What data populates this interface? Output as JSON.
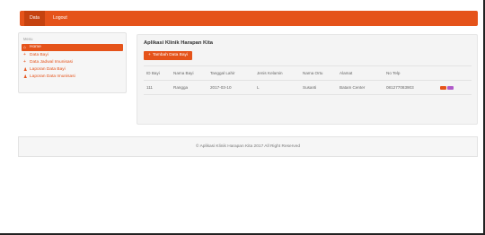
{
  "topbar": {
    "items": [
      {
        "label": "Data"
      },
      {
        "label": "Logout"
      }
    ]
  },
  "sidebar": {
    "heading": "Menu",
    "items": [
      {
        "label": "Home",
        "icon": "home-icon"
      },
      {
        "label": "Data Bayi",
        "icon": "plus-icon"
      },
      {
        "label": "Data Jadwal Imunisasi",
        "icon": "plus-icon"
      },
      {
        "label": "Laporan Data Bayi",
        "icon": "user-icon"
      },
      {
        "label": "Laporan Data Imunisasi",
        "icon": "user-icon"
      }
    ]
  },
  "content": {
    "title": "Aplikasi Klinik Harapan Kita",
    "add_button_label": "Tambah Data Bayi",
    "table": {
      "headers": [
        "ID Bayi",
        "Nama Bayi",
        "Tanggal Lahir",
        "Jenis Kelamin",
        "Nama Ortu",
        "Alamat",
        "No Telp"
      ],
      "rows": [
        {
          "id": "111",
          "nama": "Rangga",
          "tgl": "2017-03-10",
          "jk": "L",
          "ortu": "Susanti",
          "alamat": "Batam Center",
          "telp": "081277083903"
        }
      ]
    }
  },
  "footer": {
    "text": "© Aplikasi Klinik Harapan Kita 2017 All Right Reserved"
  },
  "colors": {
    "accent": "#e5531a",
    "accent_dark": "#c5420f",
    "edit": "#b05ac9"
  }
}
